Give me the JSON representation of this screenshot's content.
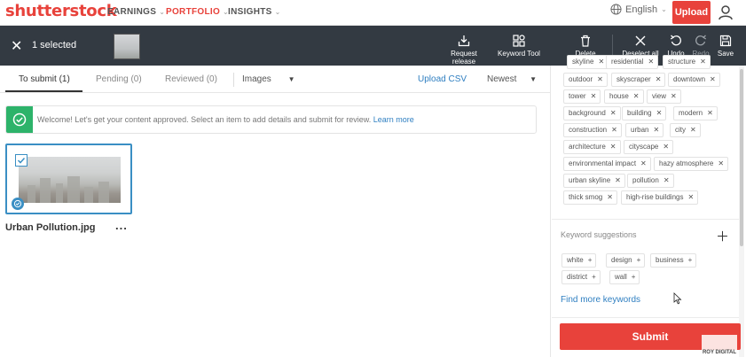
{
  "brand": {
    "logo": "shutterstock",
    "accent": "#e8423b"
  },
  "nav": {
    "earnings": "EARNINGS",
    "portfolio": "PORTFOLIO",
    "insights": "INSIGHTS",
    "language": "English",
    "upload": "Upload"
  },
  "toolbar": {
    "selected": "1 selected",
    "request_release": "Request release",
    "keyword_tool": "Keyword Tool",
    "delete": "Delete",
    "deselect_all": "Deselect all",
    "undo": "Undo",
    "redo": "Redo",
    "save": "Save"
  },
  "tabs": {
    "to_submit": "To submit (1)",
    "pending": "Pending (0)",
    "reviewed": "Reviewed (0)",
    "images": "Images",
    "upload_csv": "Upload CSV",
    "sort": "Newest"
  },
  "banner": {
    "text": "Welcome! Let's get your content approved. Select an item to add details and submit for review.",
    "link": "Learn more"
  },
  "asset": {
    "filename": "Urban Pollution.jpg",
    "more": "..."
  },
  "keywords": {
    "partial_top": [
      "skyline",
      "residential",
      "structure"
    ],
    "chips": [
      "outdoor",
      "skyscraper",
      "downtown",
      "tower",
      "house",
      "view",
      "background",
      "building",
      "modern",
      "construction",
      "urban",
      "city",
      "architecture",
      "cityscape",
      "environmental impact",
      "hazy atmosphere",
      "urban skyline",
      "pollution",
      "thick smog",
      "high-rise buildings"
    ]
  },
  "suggestions": {
    "title": "Keyword suggestions",
    "items": [
      "white",
      "design",
      "business",
      "district",
      "wall"
    ],
    "find_more": "Find more keywords"
  },
  "submit": "Submit",
  "watermark": "ROY DIGITAL"
}
